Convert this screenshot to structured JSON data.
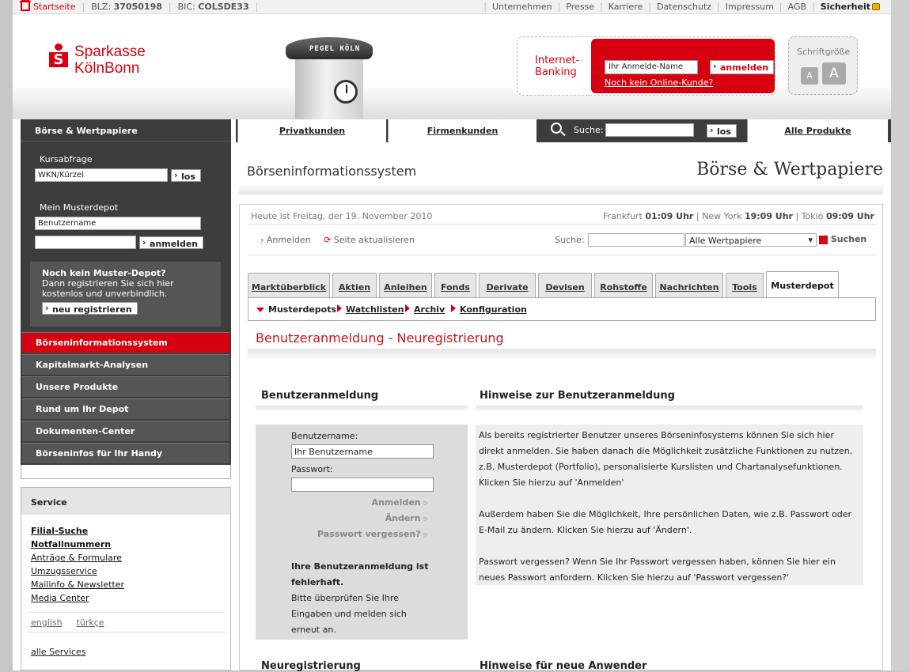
{
  "topbar": {
    "home": "Startseite",
    "blz_label": "BLZ:",
    "blz": "37050198",
    "bic_label": "BIC:",
    "bic": "COLSDE33",
    "links": [
      "Unternehmen",
      "Presse",
      "Karriere",
      "Datenschutz",
      "Impressum",
      "AGB"
    ],
    "security": "Sicherheit"
  },
  "logo": {
    "line1": "Sparkasse",
    "line2": "KölnBonn"
  },
  "tower_sign": "PEGEL KÖLN",
  "banking": {
    "label1": "Internet-",
    "label2": "Banking",
    "user_placeholder": "Ihr Anmelde-Name",
    "login": "anmelden",
    "new": "Noch kein Online-Kunde?"
  },
  "fontsize": {
    "label": "Schriftgröße",
    "small": "A",
    "large": "A"
  },
  "left": {
    "header": "Börse & Wertpapiere",
    "quote_label": "Kursabfrage",
    "quote_value": "WKN/Kürzel",
    "quote_btn": "los",
    "depot_label": "Mein Musterdepot",
    "user_value": "Benutzername",
    "login_btn": "anmelden",
    "reg_title": "Noch kein Muster-Depot?",
    "reg_text1": "Dann registrieren Sie sich hier",
    "reg_text2": "kostenlos und unverbindlich.",
    "reg_btn": "neu registrieren",
    "menu": [
      "Börseninformationssystem",
      "Kapitalmarkt-Analysen",
      "Unsere Produkte",
      "Rund um Ihr Depot",
      "Dokumenten-Center",
      "Börseninfos für Ihr Handy"
    ]
  },
  "service": {
    "title": "Service",
    "links": [
      "Filial-Suche",
      "Notfallnummern",
      "Anträge & Formulare",
      "Umzugsservice",
      "Mailinfo & Newsletter",
      "Media Center"
    ],
    "lang": [
      "english",
      "türkçe"
    ],
    "all": "alle Services"
  },
  "topnav": {
    "private": "Privatkunden",
    "business": "Firmenkunden",
    "search_label": "Suche:",
    "search_btn": "los",
    "all": "Alle Produkte"
  },
  "content": {
    "title": "Börseninformationssystem",
    "brand": "Börse & Wertpapiere",
    "date": "Heute ist Freitag, der 19. November 2010",
    "clocks": {
      "f": "Frankfurt",
      "ft": "01:09 Uhr",
      "n": "New York",
      "nt": "19:09 Uhr",
      "t": "Tokio",
      "tt": "09:09 Uhr"
    },
    "login": "Anmelden",
    "refresh": "Seite aktualisieren",
    "search_label": "Suche:",
    "search_select": "Alle Wertpapiere",
    "search_btn": "Suchen",
    "tabs": [
      "Marktüberblick",
      "Aktien",
      "Anleihen",
      "Fonds",
      "Derivate",
      "Devisen",
      "Rohstoffe",
      "Nachrichten",
      "Tools",
      "Musterdepot"
    ],
    "subnav": [
      "Musterdepots",
      "Watchlisten",
      "Archiv",
      "Konfiguration"
    ],
    "heading": "Benutzeranmeldung - Neuregistrierung",
    "login_title": "Benutzeranmeldung",
    "hint_title": "Hinweise zur Benutzeranmeldung",
    "user_label": "Benutzername:",
    "user_value": "Ihr Benutzername",
    "pass_label": "Passwort:",
    "btn_login": "Anmelden",
    "btn_change": "Ändern",
    "btn_forgot": "Passwort vergessen?",
    "err_bold": "Ihre Benutzeranmeldung ist fehlerhaft.",
    "err_text": "Bitte überprüfen Sie Ihre Eingaben und melden sich erneut an.",
    "hint1": "Als bereits registrierter Benutzer unseres Börseninfosystems können Sie sich hier direkt anmelden. Sie haben danach die Möglichkeit zusätzliche Funktionen zu nutzen, z.B. Musterdepot (Portfolio), personalisierte Kurslisten und Chartanalysefunktionen. Klicken Sie hierzu auf 'Anmelden'",
    "hint2": "Außerdem haben Sie die Möglichkeit, Ihre persönlichen Daten, wie z.B. Passwort oder E-Mail zu ändern. Klicken Sie hierzu auf 'Ändern'.",
    "hint3": "Passwort vergessen? Wenn Sie Ihr Passwort vergessen haben, können Sie hier ein neues Passwort anfordern. Klicken Sie hierzu auf 'Passwort vergessen?'",
    "reg_title": "Neuregistrierung",
    "new_title": "Hinweise für neue Anwender"
  }
}
